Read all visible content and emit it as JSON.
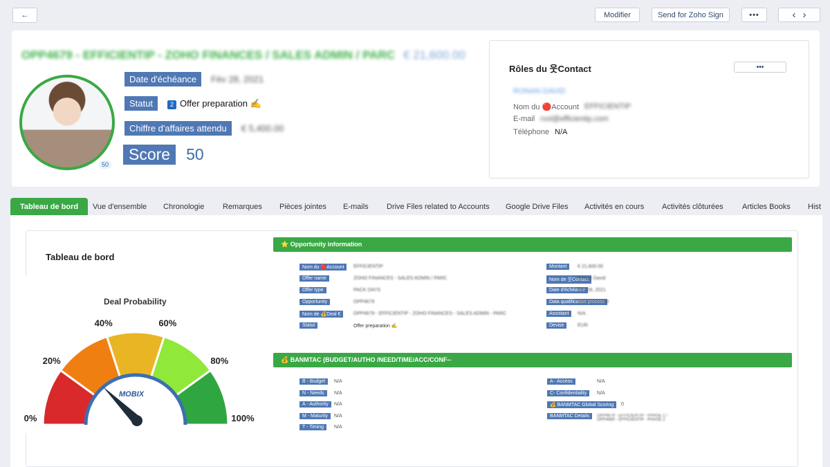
{
  "toolbar": {
    "back_label": "←",
    "modify_label": "Modifier",
    "zoho_sign_label": "Send for Zoho Sign",
    "more_label": "•••",
    "prev_label": "‹",
    "next_label": "›"
  },
  "header": {
    "title": "OPP4679 - EFFICIENTIP - ZOHO FINANCES / SALES ADMIN / PARC",
    "amount": "€ 21,600.00",
    "avatar_badge": "50",
    "fields": {
      "due_date_label": "Date d'échéance",
      "due_date_value": "Fév 28, 2021",
      "status_label": "Statut",
      "status_badge": "2",
      "status_value": "Offer preparation ✍",
      "revenue_label": "Chiffre d'affaires attendu",
      "revenue_value": "€ 5,400.00",
      "score_label": "Score",
      "score_value": "50"
    }
  },
  "contact_roles": {
    "title": "Rôles du 웃Contact",
    "more_label": "•••",
    "name": "RONAN DAVID",
    "account_label": "Nom du 🔴Account",
    "account_value": "EFFICIENTIP",
    "email_label": "E-mail",
    "email_value": "rxxl@efficientip.com",
    "phone_label": "Téléphone",
    "phone_value": "N/A"
  },
  "tabs": [
    "Tableau de bord",
    "Vue d'ensemble",
    "Chronologie",
    "Remarques",
    "Pièces jointes",
    "E-mails",
    "Drive Files related to Accounts",
    "Google Drive Files",
    "Activités en cours",
    "Activités clôturées",
    "Articles Books",
    "Hist"
  ],
  "dashboard": {
    "title": "Tableau de bord",
    "gauge_title": "Deal Probability",
    "gauge_labels": [
      "0%",
      "20%",
      "40%",
      "60%",
      "80%",
      "100%"
    ],
    "gauge_logo": "MOBIX",
    "gauge_value_percent": 25,
    "colors": {
      "red": "#d9292b",
      "orange": "#f07f12",
      "yellow": "#e9b525",
      "lime": "#8fe83a",
      "green": "#2fa640",
      "needle": "#1f2d3b",
      "hub": "#3d6fb0"
    }
  },
  "opportunity": {
    "header": "⭐ Opportunity information",
    "left": [
      {
        "label": "Nom du 🔴Account",
        "value": "EFFICIENTIP"
      },
      {
        "label": "Offer name",
        "value": "ZOHO FINANCES - SALES ADMIN / PARC"
      },
      {
        "label": "Offer type",
        "value": "PACK DAYS"
      },
      {
        "label": "Opportunity",
        "value": "OPP4679"
      },
      {
        "label": "Nom de 💰Deal €",
        "value": "OPP4679 - EFFICIENTIP - ZOHO FINANCES - SALES ADMIN - PARC"
      },
      {
        "label": "Statut",
        "value": "Offer preparation ✍"
      }
    ],
    "right": [
      {
        "label": "Montant",
        "value": "€ 21,600.00"
      },
      {
        "label": "Nom de 웃Contact",
        "value": "Ronan David"
      },
      {
        "label": "Date d'échéance",
        "value": "Fév 28, 2021"
      },
      {
        "label": "Data qualification process",
        "value": "Not processed"
      },
      {
        "label": "Assistant",
        "value": "N/A"
      },
      {
        "label": "Devise",
        "value": "EUR"
      }
    ]
  },
  "banmtac": {
    "header": "💰 BANMTAC (BUDGET/AUTHO /NEED/TIME/ACC/CONF--",
    "left": [
      {
        "label": "B - Budget",
        "value": "N/A"
      },
      {
        "label": "N - Needs",
        "value": "N/A"
      },
      {
        "label": "A - Authority",
        "value": "N/A"
      },
      {
        "label": "M - Maturity",
        "value": "N/A"
      },
      {
        "label": "T - Timing",
        "value": "N/A"
      }
    ],
    "right": [
      {
        "label": "A - Access",
        "value": "N/A"
      },
      {
        "label": "C- Confidentiality",
        "value": "N/A"
      },
      {
        "label": "💰 BANMTAC Global Scoring",
        "value": "0"
      },
      {
        "label": "BANMTAC Details",
        "value": "OPP4679 - EFFICIENTIP - PHASE 1 / OPP4680 - EFFICIENTIP - PHASE 2"
      }
    ]
  }
}
